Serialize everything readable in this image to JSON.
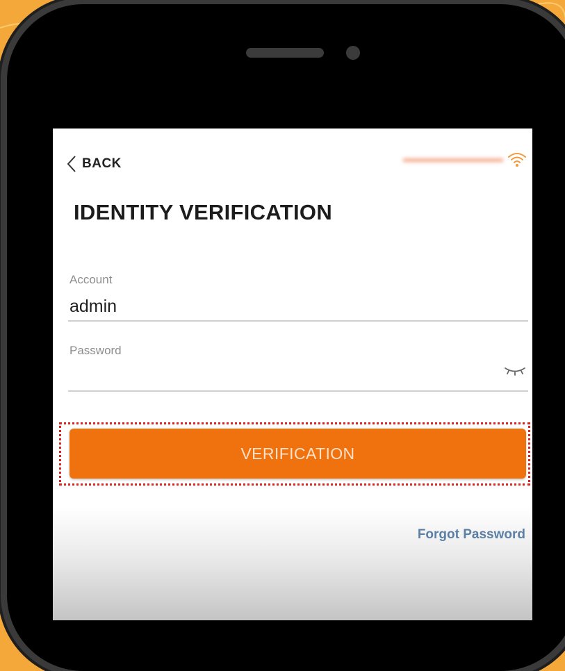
{
  "nav": {
    "back_label": "BACK"
  },
  "header": {
    "title": "IDENTITY VERIFICATION"
  },
  "status": {
    "icon": "wifi-icon",
    "accent": "#f39a3c"
  },
  "form": {
    "account_label": "Account",
    "account_value": "admin",
    "password_label": "Password",
    "password_toggle_icon": "eye-closed-icon"
  },
  "actions": {
    "verify_label": "VERIFICATION",
    "forgot_label": "Forgot Password"
  },
  "colors": {
    "background": "#f5a83a",
    "primary_button": "#f0720f",
    "link": "#5b7fa6",
    "highlight_border": "#e0201c"
  }
}
